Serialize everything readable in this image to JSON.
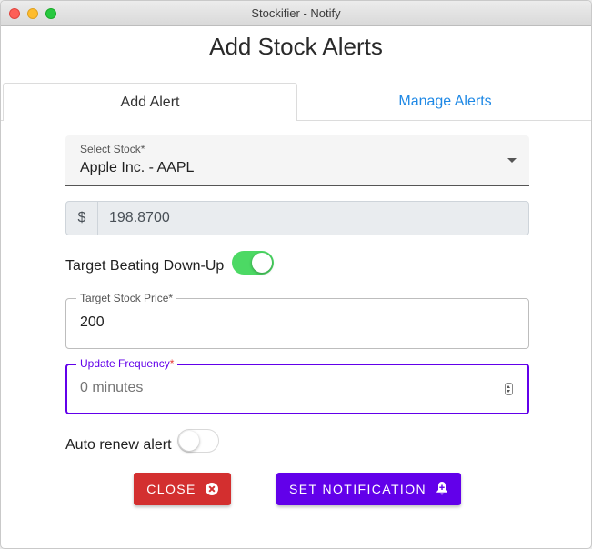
{
  "window": {
    "title": "Stockifier - Notify"
  },
  "dialog": {
    "title": "Add Stock Alerts"
  },
  "tabs": [
    {
      "label": "Add Alert",
      "active": true
    },
    {
      "label": "Manage Alerts",
      "active": false
    }
  ],
  "form": {
    "select_stock": {
      "label": "Select Stock*",
      "value": "Apple Inc. - AAPL"
    },
    "current_price": {
      "prefix": "$",
      "value": "198.8700"
    },
    "target_direction": {
      "label": "Target Beating Down-Up",
      "on": true
    },
    "target_price": {
      "label": "Target Stock Price*",
      "value": "200"
    },
    "update_frequency": {
      "label": "Update Frequency",
      "required_mark": "*",
      "placeholder": "0 minutes"
    },
    "auto_renew": {
      "label": "Auto renew alert",
      "on": false
    }
  },
  "buttons": {
    "close": {
      "label": "CLOSE",
      "icon": "close-circle-icon",
      "color": "#d32f2f"
    },
    "set_notification": {
      "label": "SET NOTIFICATION",
      "icon": "bell-plus-icon",
      "color": "#6200ea"
    }
  },
  "colors": {
    "accent": "#6200ea",
    "link": "#1e88e5",
    "toggle_on": "#4cd964"
  }
}
